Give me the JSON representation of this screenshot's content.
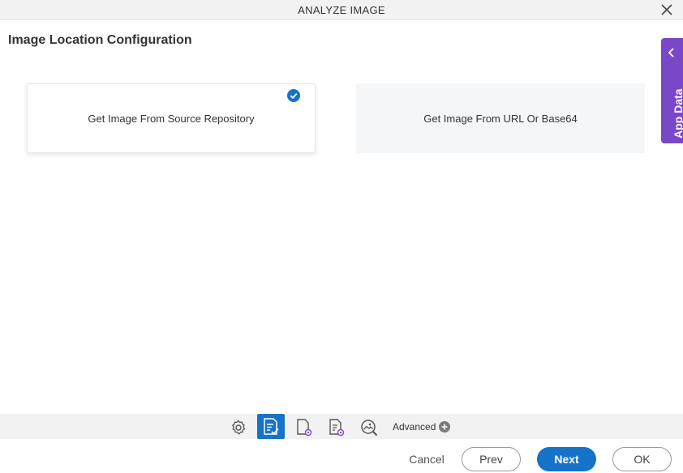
{
  "window": {
    "title": "ANALYZE IMAGE"
  },
  "page": {
    "title": "Image Location Configuration"
  },
  "options": [
    {
      "label": "Get Image From Source Repository",
      "selected": true
    },
    {
      "label": "Get Image From URL Or Base64",
      "selected": false
    }
  ],
  "side_panel": {
    "label": "App Data"
  },
  "toolbar": {
    "icons": [
      "gear-icon",
      "form-check-icon",
      "document-settings-icon",
      "document-list-settings-icon",
      "image-search-icon"
    ],
    "active_index": 1,
    "advanced_label": "Advanced"
  },
  "footer": {
    "cancel_label": "Cancel",
    "prev_label": "Prev",
    "next_label": "Next",
    "ok_label": "OK"
  },
  "colors": {
    "accent": "#1773c9",
    "side_panel": "#7b47c9",
    "toolbar_bg": "#f2f2f2"
  }
}
